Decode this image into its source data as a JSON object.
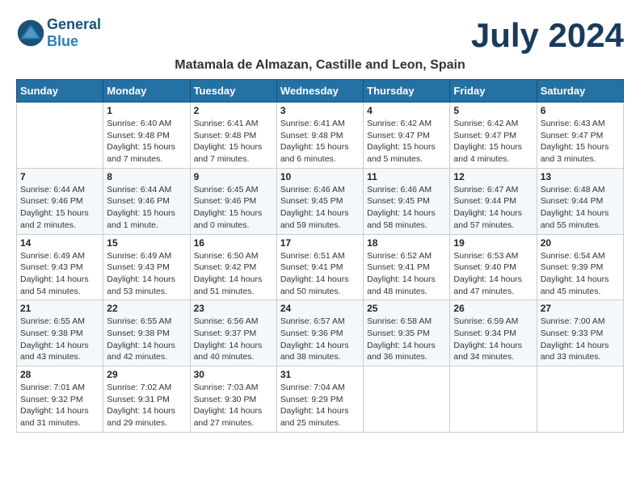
{
  "header": {
    "month_title": "July 2024",
    "location": "Matamala de Almazan, Castille and Leon, Spain",
    "logo_general": "General",
    "logo_blue": "Blue"
  },
  "weekdays": [
    "Sunday",
    "Monday",
    "Tuesday",
    "Wednesday",
    "Thursday",
    "Friday",
    "Saturday"
  ],
  "weeks": [
    [
      {
        "day": "",
        "info": ""
      },
      {
        "day": "1",
        "info": "Sunrise: 6:40 AM\nSunset: 9:48 PM\nDaylight: 15 hours\nand 7 minutes."
      },
      {
        "day": "2",
        "info": "Sunrise: 6:41 AM\nSunset: 9:48 PM\nDaylight: 15 hours\nand 7 minutes."
      },
      {
        "day": "3",
        "info": "Sunrise: 6:41 AM\nSunset: 9:48 PM\nDaylight: 15 hours\nand 6 minutes."
      },
      {
        "day": "4",
        "info": "Sunrise: 6:42 AM\nSunset: 9:47 PM\nDaylight: 15 hours\nand 5 minutes."
      },
      {
        "day": "5",
        "info": "Sunrise: 6:42 AM\nSunset: 9:47 PM\nDaylight: 15 hours\nand 4 minutes."
      },
      {
        "day": "6",
        "info": "Sunrise: 6:43 AM\nSunset: 9:47 PM\nDaylight: 15 hours\nand 3 minutes."
      }
    ],
    [
      {
        "day": "7",
        "info": "Sunrise: 6:44 AM\nSunset: 9:46 PM\nDaylight: 15 hours\nand 2 minutes."
      },
      {
        "day": "8",
        "info": "Sunrise: 6:44 AM\nSunset: 9:46 PM\nDaylight: 15 hours\nand 1 minute."
      },
      {
        "day": "9",
        "info": "Sunrise: 6:45 AM\nSunset: 9:46 PM\nDaylight: 15 hours\nand 0 minutes."
      },
      {
        "day": "10",
        "info": "Sunrise: 6:46 AM\nSunset: 9:45 PM\nDaylight: 14 hours\nand 59 minutes."
      },
      {
        "day": "11",
        "info": "Sunrise: 6:46 AM\nSunset: 9:45 PM\nDaylight: 14 hours\nand 58 minutes."
      },
      {
        "day": "12",
        "info": "Sunrise: 6:47 AM\nSunset: 9:44 PM\nDaylight: 14 hours\nand 57 minutes."
      },
      {
        "day": "13",
        "info": "Sunrise: 6:48 AM\nSunset: 9:44 PM\nDaylight: 14 hours\nand 55 minutes."
      }
    ],
    [
      {
        "day": "14",
        "info": "Sunrise: 6:49 AM\nSunset: 9:43 PM\nDaylight: 14 hours\nand 54 minutes."
      },
      {
        "day": "15",
        "info": "Sunrise: 6:49 AM\nSunset: 9:43 PM\nDaylight: 14 hours\nand 53 minutes."
      },
      {
        "day": "16",
        "info": "Sunrise: 6:50 AM\nSunset: 9:42 PM\nDaylight: 14 hours\nand 51 minutes."
      },
      {
        "day": "17",
        "info": "Sunrise: 6:51 AM\nSunset: 9:41 PM\nDaylight: 14 hours\nand 50 minutes."
      },
      {
        "day": "18",
        "info": "Sunrise: 6:52 AM\nSunset: 9:41 PM\nDaylight: 14 hours\nand 48 minutes."
      },
      {
        "day": "19",
        "info": "Sunrise: 6:53 AM\nSunset: 9:40 PM\nDaylight: 14 hours\nand 47 minutes."
      },
      {
        "day": "20",
        "info": "Sunrise: 6:54 AM\nSunset: 9:39 PM\nDaylight: 14 hours\nand 45 minutes."
      }
    ],
    [
      {
        "day": "21",
        "info": "Sunrise: 6:55 AM\nSunset: 9:38 PM\nDaylight: 14 hours\nand 43 minutes."
      },
      {
        "day": "22",
        "info": "Sunrise: 6:55 AM\nSunset: 9:38 PM\nDaylight: 14 hours\nand 42 minutes."
      },
      {
        "day": "23",
        "info": "Sunrise: 6:56 AM\nSunset: 9:37 PM\nDaylight: 14 hours\nand 40 minutes."
      },
      {
        "day": "24",
        "info": "Sunrise: 6:57 AM\nSunset: 9:36 PM\nDaylight: 14 hours\nand 38 minutes."
      },
      {
        "day": "25",
        "info": "Sunrise: 6:58 AM\nSunset: 9:35 PM\nDaylight: 14 hours\nand 36 minutes."
      },
      {
        "day": "26",
        "info": "Sunrise: 6:59 AM\nSunset: 9:34 PM\nDaylight: 14 hours\nand 34 minutes."
      },
      {
        "day": "27",
        "info": "Sunrise: 7:00 AM\nSunset: 9:33 PM\nDaylight: 14 hours\nand 33 minutes."
      }
    ],
    [
      {
        "day": "28",
        "info": "Sunrise: 7:01 AM\nSunset: 9:32 PM\nDaylight: 14 hours\nand 31 minutes."
      },
      {
        "day": "29",
        "info": "Sunrise: 7:02 AM\nSunset: 9:31 PM\nDaylight: 14 hours\nand 29 minutes."
      },
      {
        "day": "30",
        "info": "Sunrise: 7:03 AM\nSunset: 9:30 PM\nDaylight: 14 hours\nand 27 minutes."
      },
      {
        "day": "31",
        "info": "Sunrise: 7:04 AM\nSunset: 9:29 PM\nDaylight: 14 hours\nand 25 minutes."
      },
      {
        "day": "",
        "info": ""
      },
      {
        "day": "",
        "info": ""
      },
      {
        "day": "",
        "info": ""
      }
    ]
  ]
}
